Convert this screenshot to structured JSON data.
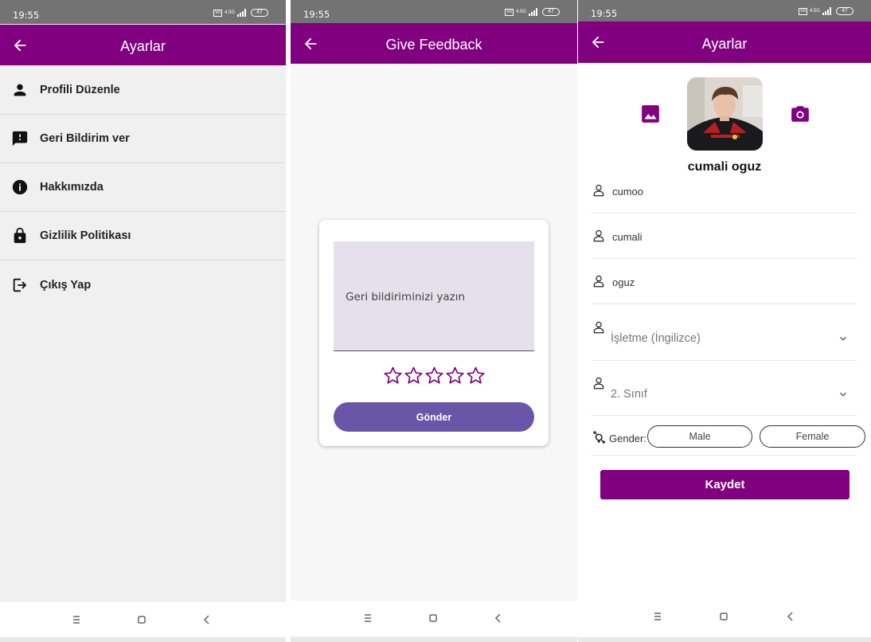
{
  "colors": {
    "primary": "#800080",
    "status_bar": "#737373",
    "send_button": "#6a55a8",
    "feedback_field": "#e6dfec"
  },
  "status": {
    "time": "19:55",
    "network": "4.5G",
    "volte": "Vo",
    "battery": "47"
  },
  "settings_menu": {
    "title": "Ayarlar",
    "items": [
      {
        "label": "Profili Düzenle",
        "icon": "person-icon"
      },
      {
        "label": "Geri Bildirim ver",
        "icon": "feedback-icon"
      },
      {
        "label": "Hakkımızda",
        "icon": "info-icon"
      },
      {
        "label": "Gizlilik Politikası",
        "icon": "lock-icon"
      },
      {
        "label": "Çıkış Yap",
        "icon": "logout-icon"
      }
    ]
  },
  "feedback": {
    "title": "Give Feedback",
    "placeholder": "Geri bildiriminizi yazın",
    "rating": 0,
    "rating_max": 5,
    "send_label": "Gönder"
  },
  "profile": {
    "title": "Ayarlar",
    "full_name": "cumali oguz",
    "fields": [
      {
        "value": "cumoo",
        "icon": "user-outline-icon"
      },
      {
        "value": "cumali",
        "icon": "user-outline-icon"
      },
      {
        "value": "oguz",
        "icon": "user-outline-icon"
      }
    ],
    "selects": [
      {
        "value": "İşletme (İngilizce)",
        "icon": "user-outline-icon"
      },
      {
        "value": "2. Sınıf",
        "icon": "user-outline-icon"
      }
    ],
    "gender_label": "Gender:",
    "gender_options": [
      "Male",
      "Female"
    ],
    "save_label": "Kaydet"
  },
  "nav": {
    "icons": [
      "menu-icon",
      "home-icon",
      "back-icon"
    ]
  }
}
